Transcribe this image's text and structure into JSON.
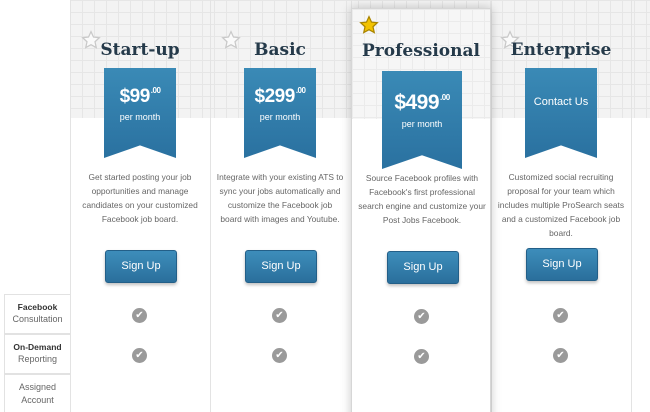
{
  "plans": [
    {
      "name": "Start-up",
      "price": "$99",
      "cents": ".00",
      "period": "per month",
      "description": "Get started posting your job opportunities and manage candidates on your customized Facebook job board.",
      "button": "Sign Up",
      "star": "empty-star"
    },
    {
      "name": "Basic",
      "price": "$299",
      "cents": ".00",
      "period": "per month",
      "description": "Integrate with your existing ATS to sync your jobs automatically and customize the Facebook job board with images and Youtube.",
      "button": "Sign Up",
      "star": "empty-star"
    },
    {
      "name": "Professional",
      "price": "$499",
      "cents": ".00",
      "period": "per month",
      "description": "Source Facebook profiles with Facebook's first professional search engine and customize your Post Jobs Facebook.",
      "button": "Sign Up",
      "star": "gold-star"
    },
    {
      "name": "Enterprise",
      "contact": "Contact Us",
      "description": "Customized social recruiting proposal for your team which includes multiple ProSearch seats and a customized Facebook job board.",
      "button": "Sign Up",
      "star": "empty-star"
    }
  ],
  "features": [
    {
      "label": "Facebook",
      "sub": "Consultation",
      "included": [
        true,
        true,
        true,
        true
      ]
    },
    {
      "label": "On-Demand",
      "sub": "Reporting",
      "included": [
        true,
        true,
        true,
        true
      ]
    },
    {
      "label": "Assigned Account",
      "included": []
    }
  ],
  "colors": {
    "ribbon": "#2f7cab",
    "button": "#2f7aa8",
    "title": "#253a4a",
    "star_gold": "#f2c200",
    "check": "#9a9a9a"
  }
}
